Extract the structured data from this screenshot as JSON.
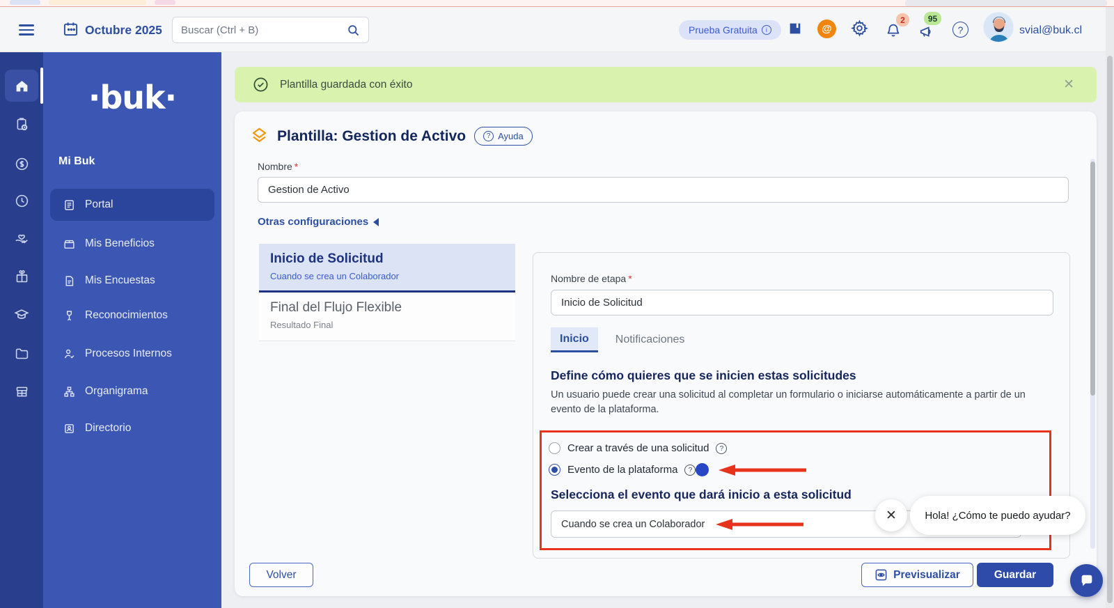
{
  "topbar": {
    "date": "Octubre 2025",
    "search_placeholder": "Buscar (Ctrl + B)",
    "trial_label": "Prueba Gratuita",
    "notifications_badge": "2",
    "announcements_badge": "95",
    "user_email": "svial@buk.cl"
  },
  "sidebar": {
    "logo": "·buk·",
    "section_title": "Mi Buk",
    "items": [
      {
        "label": "Portal"
      },
      {
        "label": "Mis Beneficios"
      },
      {
        "label": "Mis Encuestas"
      },
      {
        "label": "Reconocimientos"
      },
      {
        "label": "Procesos Internos"
      },
      {
        "label": "Organigrama"
      },
      {
        "label": "Directorio"
      }
    ]
  },
  "banner": {
    "message": "Plantilla guardada con éxito"
  },
  "template": {
    "title": "Plantilla: Gestion de Activo",
    "help_label": "Ayuda",
    "required_mark": "*",
    "name_label": "Nombre",
    "name_value": "Gestion de Activo",
    "other_settings_label": "Otras configuraciones",
    "stages": [
      {
        "title": "Inicio de Solicitud",
        "subtitle": "Cuando se crea un Colaborador"
      },
      {
        "title": "Final del Flujo Flexible",
        "subtitle": "Resultado Final"
      }
    ],
    "stage_panel": {
      "name_label": "Nombre de etapa",
      "name_value": "Inicio de Solicitud",
      "tabs": [
        {
          "label": "Inicio"
        },
        {
          "label": "Notificaciones"
        }
      ],
      "section_title": "Define cómo quieres que se inicien estas solicitudes",
      "section_description": "Un usuario puede crear una solicitud al completar un formulario o iniciarse automáticamente a partir de un evento de la plataforma.",
      "options": [
        {
          "label": "Crear a través de una solicitud",
          "selected": false
        },
        {
          "label": "Evento de la plataforma",
          "selected": true
        }
      ],
      "event_label": "Selecciona el evento que dará inicio a esta solicitud",
      "event_value": "Cuando se crea un Colaborador"
    },
    "actions": {
      "back": "Volver",
      "preview": "Previsualizar",
      "save": "Guardar"
    }
  },
  "chat": {
    "greeting": "Hola! ¿Cómo te puedo ayudar?"
  },
  "colors": {
    "accent_blue": "#2d4fa1",
    "sidebar_blue": "#3b56b3",
    "rail_blue": "#293f8e",
    "success_bg": "#d9f2ae",
    "annotation_red": "#e8331c",
    "save_button": "#2e4ba9"
  }
}
